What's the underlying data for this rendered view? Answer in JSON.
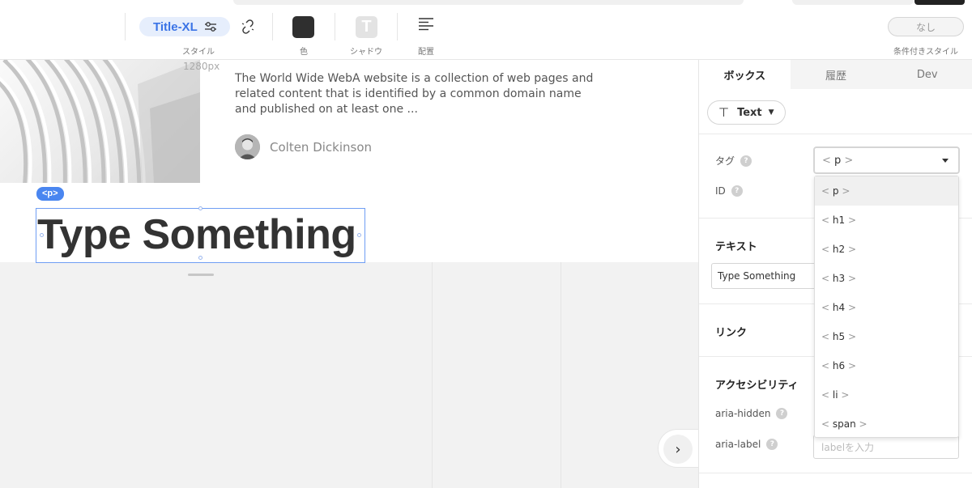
{
  "toolbar": {
    "style_chip_label": "Title-XL",
    "style_caption": "スタイル",
    "color_caption": "色",
    "shadow_glyph": "T",
    "shadow_caption": "シャドウ",
    "align_caption": "配置",
    "conditional_value": "なし",
    "conditional_caption": "条件付きスタイル",
    "icons": [
      "sliders-icon",
      "unlink-icon",
      "color-swatch",
      "text-shadow-icon",
      "align-left-icon"
    ]
  },
  "canvas": {
    "width_label": "1280px",
    "article_excerpt": "The World Wide WebA website is a collection of web pages and related content that is identified by a common domain name and published on at least one ...",
    "author_name": "Colten Dickinson",
    "selected_tag_badge": "<p>",
    "heading_text": "Type Something",
    "expand_glyph": "›"
  },
  "panel": {
    "tabs": [
      {
        "label": "ボックス",
        "active": true
      },
      {
        "label": "履歴",
        "active": false
      },
      {
        "label": "Dev",
        "active": false
      }
    ],
    "type_chip_icon": "⊤",
    "type_chip_label": "Text",
    "tag_label": "タグ",
    "id_label": "ID",
    "text_section": "テキスト",
    "text_value": "Type Something",
    "link_section": "リンク",
    "a11y_section": "アクセシビリティ",
    "aria_hidden_label": "aria-hidden",
    "aria_label_label": "aria-label",
    "aria_label_placeholder": "labelを入力",
    "help_glyph": "?"
  },
  "tag_select": {
    "selected": "p",
    "options": [
      "p",
      "h1",
      "h2",
      "h3",
      "h4",
      "h5",
      "h6",
      "li",
      "span"
    ]
  },
  "colors": {
    "accent": "#3b74e6",
    "selection_border": "#6f9ef4",
    "badge": "#4a86f0"
  }
}
